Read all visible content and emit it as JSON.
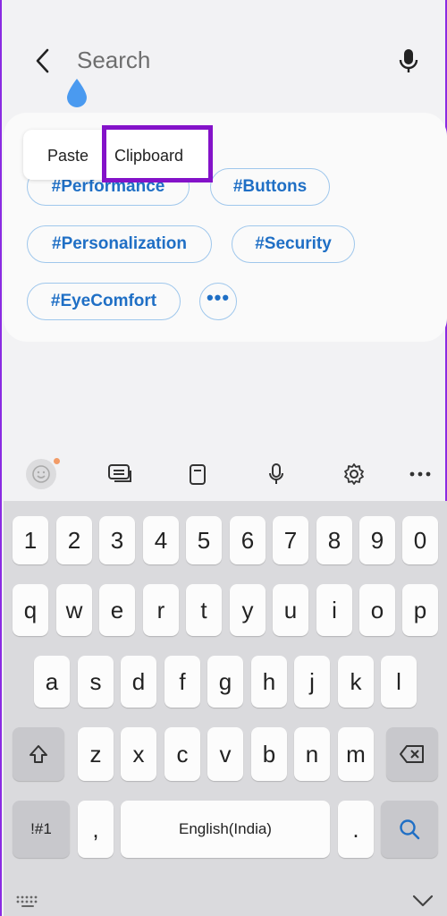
{
  "search": {
    "placeholder": "Search"
  },
  "tags": [
    "#Performance",
    "#Buttons",
    "#Personalization",
    "#Security",
    "#EyeComfort"
  ],
  "more_label": "•••",
  "popup": {
    "paste": "Paste",
    "clipboard": "Clipboard"
  },
  "keyboard": {
    "numbers": [
      "1",
      "2",
      "3",
      "4",
      "5",
      "6",
      "7",
      "8",
      "9",
      "0"
    ],
    "row1": [
      "q",
      "w",
      "e",
      "r",
      "t",
      "y",
      "u",
      "i",
      "o",
      "p"
    ],
    "row2": [
      "a",
      "s",
      "d",
      "f",
      "g",
      "h",
      "j",
      "k",
      "l"
    ],
    "row3": [
      "z",
      "x",
      "c",
      "v",
      "b",
      "n",
      "m"
    ],
    "symbols_key": "!#1",
    "comma": ",",
    "space_label": "English(India)",
    "period": "."
  },
  "colors": {
    "accent": "#1f6fc5",
    "highlight": "#8412c9",
    "drop": "#4a9af0"
  }
}
